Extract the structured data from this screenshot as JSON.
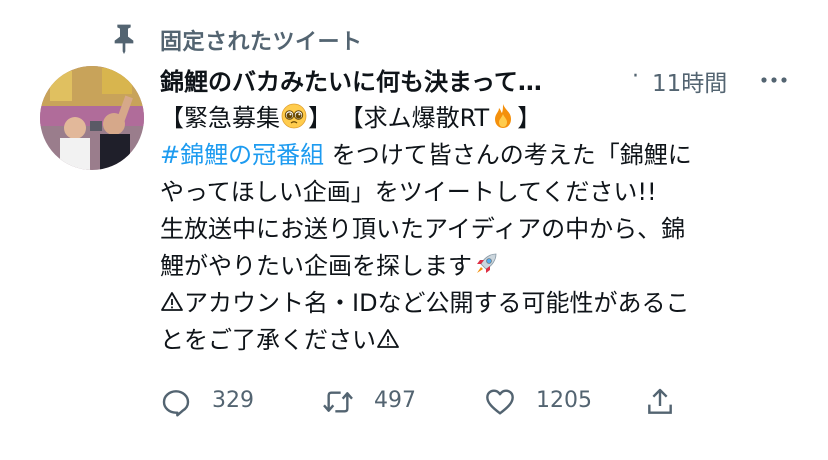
{
  "pinned": {
    "label": "固定されたツイート"
  },
  "tweet": {
    "author_name": "錦鯉のバカみたいに何も決まって…",
    "separator": "·",
    "timestamp": "11時間",
    "body": {
      "line1_a": "【緊急募集",
      "line1_b": "】 【求ム爆散RT",
      "line1_c": "】",
      "hashtag": "#錦鯉の冠番組",
      "line2_rest": " をつけて皆さんの考えた「錦鯉に",
      "line3": "やってほしい企画」をツイートしてください!!",
      "line4": "生放送中にお送り頂いたアイディアの中から、錦",
      "line5": "鯉がやりたい企画を探します",
      "line6": "アカウント名・IDなど公開する可能性があるこ",
      "line7": "とをご了承ください"
    },
    "emojis": [
      "pleading-face",
      "fire",
      "rocket",
      "warning-sign"
    ]
  },
  "actions": {
    "reply_count": "329",
    "retweet_count": "497",
    "like_count": "1205"
  },
  "colors": {
    "text": "#0f1419",
    "secondary": "#536471",
    "link": "#1d9bf0"
  }
}
